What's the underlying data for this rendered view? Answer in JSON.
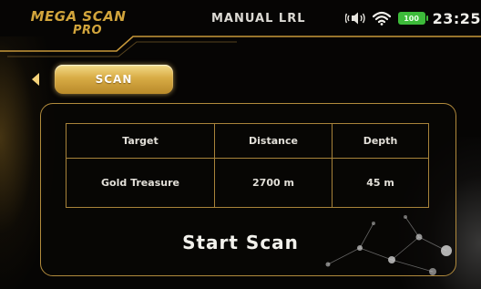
{
  "header": {
    "brand_line1": "MEGA SCAN",
    "brand_line2": "PRO",
    "title": "MANUAL LRL",
    "status": {
      "sound_icon": "speaker-icon",
      "wifi_icon": "wifi-icon",
      "battery_label": "100",
      "battery_color": "#3dbb3a",
      "time": "23:25"
    }
  },
  "nav": {
    "back_icon": "back-arrow-icon",
    "tab_label": "SCAN"
  },
  "table": {
    "headers": [
      "Target",
      "Distance",
      "Depth"
    ],
    "rows": [
      [
        "Gold Treasure",
        "2700 m",
        "45 m"
      ]
    ]
  },
  "actions": {
    "start_label": "Start Scan"
  },
  "colors": {
    "accent_gold": "#d2a53c",
    "panel_border": "#b18a3c",
    "background": "#060504"
  }
}
